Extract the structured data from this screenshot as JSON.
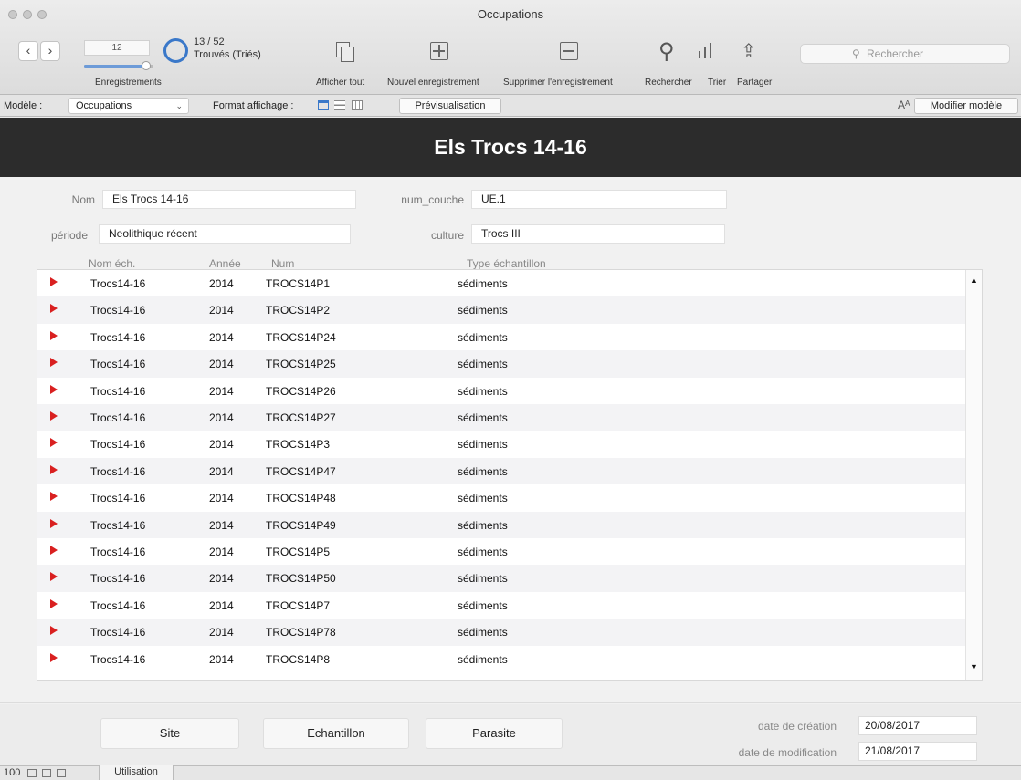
{
  "window": {
    "title": "Occupations"
  },
  "toolbar": {
    "record_field": "12",
    "records_label": "Enregistrements",
    "found_count": "13 / 52",
    "found_label": "Trouvés (Triés)",
    "show_all": "Afficher tout",
    "new_record": "Nouvel enregistrement",
    "delete_record": "Supprimer l'enregistrement",
    "find": "Rechercher",
    "sort": "Trier",
    "share": "Partager",
    "search_placeholder": "Rechercher"
  },
  "layoutbar": {
    "model_label": "Modèle :",
    "model_value": "Occupations",
    "view_format_label": "Format affichage :",
    "preview": "Prévisualisation",
    "font_size_glyph": "Aᴬ",
    "edit_layout": "Modifier modèle"
  },
  "record": {
    "header_title": "Els Trocs 14-16",
    "fields": {
      "nom": {
        "label": "Nom",
        "value": "Els Trocs 14-16"
      },
      "num_couche": {
        "label": "num_couche",
        "value": "UE.1"
      },
      "periode": {
        "label": "période",
        "value": "Neolithique récent"
      },
      "culture": {
        "label": "culture",
        "value": "Trocs III"
      }
    }
  },
  "portal": {
    "columns": [
      "Nom éch.",
      "Année",
      "Num",
      "Type échantillon"
    ],
    "rows": [
      [
        "Trocs14-16",
        "2014",
        "TROCS14P1",
        "sédiments"
      ],
      [
        "Trocs14-16",
        "2014",
        "TROCS14P2",
        "sédiments"
      ],
      [
        "Trocs14-16",
        "2014",
        "TROCS14P24",
        "sédiments"
      ],
      [
        "Trocs14-16",
        "2014",
        "TROCS14P25",
        "sédiments"
      ],
      [
        "Trocs14-16",
        "2014",
        "TROCS14P26",
        "sédiments"
      ],
      [
        "Trocs14-16",
        "2014",
        "TROCS14P27",
        "sédiments"
      ],
      [
        "Trocs14-16",
        "2014",
        "TROCS14P3",
        "sédiments"
      ],
      [
        "Trocs14-16",
        "2014",
        "TROCS14P47",
        "sédiments"
      ],
      [
        "Trocs14-16",
        "2014",
        "TROCS14P48",
        "sédiments"
      ],
      [
        "Trocs14-16",
        "2014",
        "TROCS14P49",
        "sédiments"
      ],
      [
        "Trocs14-16",
        "2014",
        "TROCS14P5",
        "sédiments"
      ],
      [
        "Trocs14-16",
        "2014",
        "TROCS14P50",
        "sédiments"
      ],
      [
        "Trocs14-16",
        "2014",
        "TROCS14P7",
        "sédiments"
      ],
      [
        "Trocs14-16",
        "2014",
        "TROCS14P78",
        "sédiments"
      ],
      [
        "Trocs14-16",
        "2014",
        "TROCS14P8",
        "sédiments"
      ]
    ]
  },
  "buttons": {
    "site": "Site",
    "sample": "Echantillon",
    "parasite": "Parasite"
  },
  "dates": {
    "created_label": "date de création",
    "created_value": "20/08/2017",
    "modified_label": "date de modification",
    "modified_value": "21/08/2017"
  },
  "statusbar": {
    "zoom": "100",
    "mode": "Utilisation"
  },
  "colors": {
    "header_bg": "#2c2c2c",
    "row_arrow": "#d92020",
    "accent": "#3a78c9"
  }
}
